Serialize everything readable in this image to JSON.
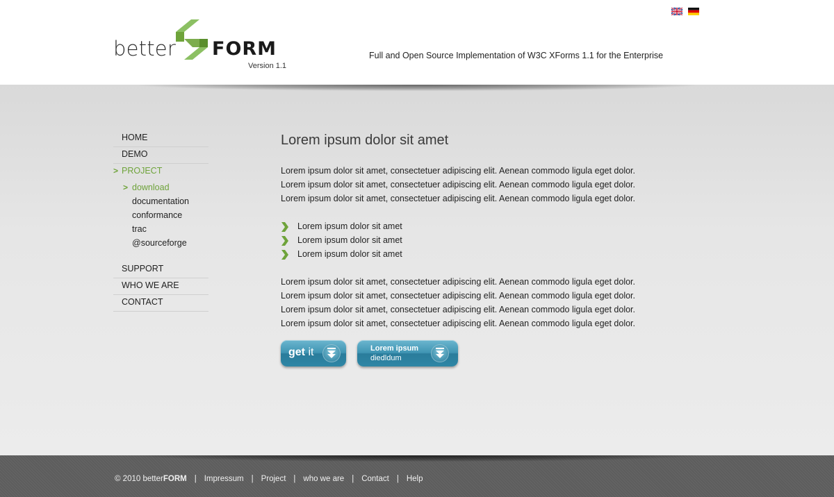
{
  "header": {
    "logo": {
      "word1": "better",
      "word2": "FORM",
      "version": "Version 1.1"
    },
    "tagline": "Full and Open Source Implementation of W3C XForms 1.1 for the Enterprise",
    "languages": [
      {
        "name": "english-flag-icon"
      },
      {
        "name": "german-flag-icon"
      }
    ]
  },
  "nav": {
    "items": [
      {
        "label": "HOME"
      },
      {
        "label": "DEMO"
      },
      {
        "label": "PROJECT",
        "active": true
      },
      {
        "label": "SUPPORT"
      },
      {
        "label": "WHO WE ARE"
      },
      {
        "label": "CONTACT"
      }
    ],
    "project_sub": [
      {
        "label": "download",
        "active": true
      },
      {
        "label": "documentation"
      },
      {
        "label": "conformance"
      },
      {
        "label": "trac"
      },
      {
        "label": "@sourceforge"
      }
    ]
  },
  "main": {
    "title": "Lorem ipsum dolor sit amet",
    "paragraph1": [
      "Lorem ipsum dolor sit amet, consectetuer adipiscing elit. Aenean commodo ligula eget dolor.",
      "Lorem ipsum dolor sit amet, consectetuer adipiscing elit. Aenean commodo ligula eget dolor.",
      "Lorem ipsum dolor sit amet, consectetuer adipiscing elit. Aenean commodo ligula eget dolor."
    ],
    "bullets": [
      "Lorem ipsum dolor sit amet",
      "Lorem ipsum dolor sit amet",
      "Lorem ipsum dolor sit amet"
    ],
    "paragraph2": [
      "Lorem ipsum dolor sit amet, consectetuer adipiscing elit. Aenean commodo ligula eget dolor.",
      "Lorem ipsum dolor sit amet, consectetuer adipiscing elit. Aenean commodo ligula eget dolor.",
      "Lorem ipsum dolor sit amet, consectetuer adipiscing elit. Aenean commodo ligula eget dolor.",
      "Lorem ipsum dolor sit amet, consectetuer adipiscing elit. Aenean commodo ligula eget dolor."
    ],
    "buttons": {
      "getit_bold": "get",
      "getit_thin": "it",
      "lorem_line1": "Lorem ipsum",
      "lorem_line2": "diedldum"
    }
  },
  "footer": {
    "copyright_prefix": "© 2010 better",
    "copyright_brand": "FORM",
    "links": [
      "Impressum",
      "Project",
      "who we are",
      "Contact",
      "Help"
    ],
    "separator": "|"
  },
  "colors": {
    "accent_green": "#6ea33a",
    "button_blue": "#3f95b3",
    "footer_gray": "#5d5d5d"
  }
}
